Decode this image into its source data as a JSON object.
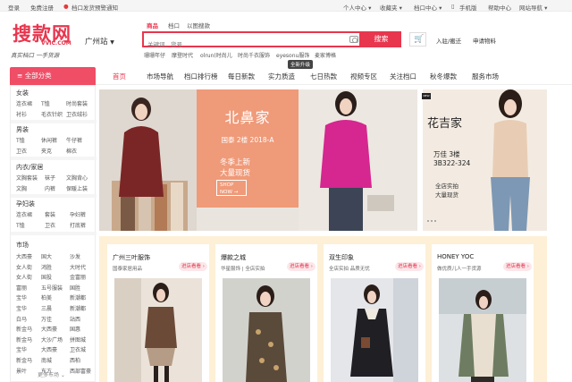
{
  "topbar": {
    "login": "登录",
    "register": "免费注册",
    "notice": "档口发货预警通知",
    "personal_center": "个人中心 ▾",
    "favorites": "收藏夹 ▾",
    "stall_center": "档口中心 ▾",
    "mobile": "手机版",
    "help": "帮助中心",
    "site_nav": "网站导航 ▾"
  },
  "header": {
    "logo_text": "搜款网",
    "logo_sub": "VVIC.COM",
    "slogan": "真实档口 一手货源",
    "city": "广州站",
    "search_tabs": [
      "商品",
      "档口",
      "以图搜款"
    ],
    "search_placeholder": "关键词、货号",
    "search_button": "搜索",
    "hot_keywords": [
      "珊珊年仔",
      "摩登时代",
      "olrun(时尚儿",
      "时尚千衣服饰",
      "eyesonu服饰",
      "麦家博格"
    ],
    "enter_link": "入驻/搬迁",
    "upload_link": "申请物料"
  },
  "nav": {
    "all_categories": "全部分类",
    "items": [
      "首页",
      "市场导航",
      "档口排行榜",
      "每日新款",
      "实力质造",
      "七日热款",
      "视频专区",
      "关注档口",
      "秋冬爆款",
      "服务市场"
    ],
    "new_tag": "全新升级"
  },
  "sidebar": {
    "women": {
      "title": "女装",
      "items": [
        "连衣裙",
        "T恤",
        "时尚套装",
        "衬衫",
        "毛衣针织",
        "卫衣绒衫"
      ]
    },
    "men": {
      "title": "男装",
      "items": [
        "T恤",
        "休闲裤",
        "牛仔裤",
        "卫衣",
        "夹克",
        "棉衣"
      ]
    },
    "underwear": {
      "title": "内衣/家居",
      "items": [
        "文胸套装",
        "袜子",
        "文胸背心",
        "文胸",
        "内裤",
        "保暖上装"
      ]
    },
    "maternity": {
      "title": "孕妇装",
      "items": [
        "连衣裙",
        "套装",
        "孕妇裤",
        "T恤",
        "卫衣",
        "打底裤"
      ]
    },
    "market": {
      "title": "市场",
      "items": [
        "大西豪",
        "国大",
        "沙发",
        "女人街",
        "鸿胜",
        "大时代",
        "女人街",
        "国投",
        "金富丽",
        "富丽",
        "五号服装",
        "国胜",
        "宝华",
        "柏美",
        "新潮都",
        "宝华",
        "三晨",
        "新潮都",
        "白马",
        "万佳",
        "站西",
        "新金马",
        "大西豪",
        "国惠",
        "新金马",
        "大沙广场",
        "拼图城",
        "宝华",
        "大西豪",
        "卫衣城",
        "新金马",
        "南城",
        "西柏",
        "景叶",
        "东方",
        "西部富豪"
      ],
      "more": "更多市场 ⌄"
    }
  },
  "banner_main": {
    "brand": "北鼻家",
    "address": "国泰 2楼 2018-A",
    "line1": "冬季上新",
    "line2": "大量现货",
    "cta": "SHOP NOW →"
  },
  "banner_side": {
    "logo": "NEW",
    "brand": "花吉家",
    "address1": "万佳 3楼",
    "address2": "3B322-324",
    "tag1": "全店实拍",
    "tag2": "大量现货"
  },
  "stores": [
    {
      "name": "广州三叶服饰",
      "desc": "国泰家居用品",
      "button": "进店看看 ›"
    },
    {
      "name": "爆款之城",
      "desc": "华星服饰 | 全店实拍",
      "button": "进店看看 ›"
    },
    {
      "name": "双生印象",
      "desc": "全店实拍 品质无忧",
      "button": "进店看看 ›"
    },
    {
      "name": "HONEY YOC",
      "desc": "做优质儿人一手货源",
      "button": "进店看看 ›"
    }
  ],
  "colors": {
    "brand": "#e8364e",
    "promo": "#ef9a79",
    "stores_bg": "#fdf0d6"
  }
}
